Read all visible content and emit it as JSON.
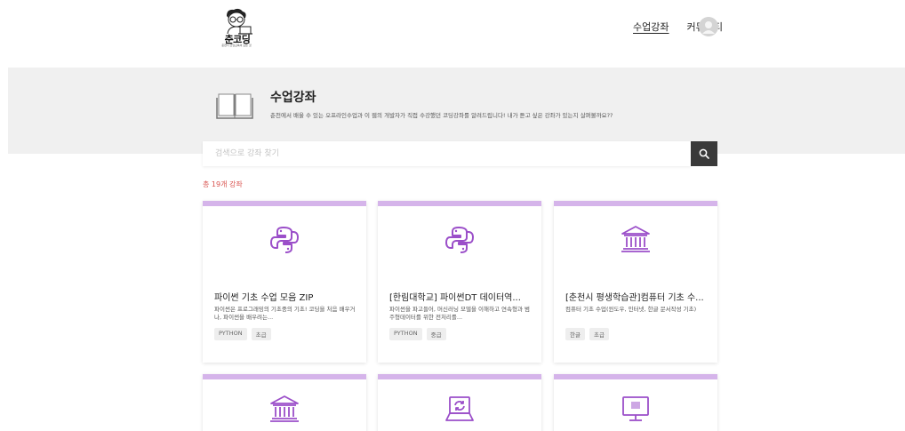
{
  "header": {
    "logo_text": "춘코딩",
    "logo_sub": "춘천시 코딩교육의 모든 것",
    "nav": [
      {
        "label": "수업강좌",
        "active": true
      },
      {
        "label": "커뮤니티",
        "active": false
      }
    ]
  },
  "banner": {
    "title": "수업강좌",
    "description": "춘천에서 배울 수 있는 오프라인수업과 이 웹의 개발자가 직접 수강했던 코딩강좌를 알려드립니다! 내가 듣고 싶은 강좌가 있는지 살펴볼까요??"
  },
  "search": {
    "placeholder": "검색으로 강좌 찾기"
  },
  "count_text": "총 19개 강좌",
  "colors": {
    "card_bar": "#d5b4ea",
    "icon_purple": "#9b4fc9",
    "count_red": "#d9534f",
    "search_button": "#3a3a3a"
  },
  "cards": [
    {
      "icon": "python-icon",
      "title": "파이썬 기초 수업 모음 ZIP",
      "description": "파이썬은 프로그래밍의 기초중의 기초! 코딩을 처음 배우거나, 파이썬을 배우려는...",
      "tags": [
        "PYTHON",
        "초급"
      ]
    },
    {
      "icon": "python-icon",
      "title": "[한림대학교] 파이썬DT 데이터역...",
      "description": "파이썬을 파고들어, 머신러닝 모델을 이해하고 연속형과 범주형데이터를 위한 전처리를...",
      "tags": [
        "PYTHON",
        "중급"
      ]
    },
    {
      "icon": "institution-icon",
      "title": "[춘천시 평생학습관]컴퓨터 기초 수...",
      "description": "컴퓨터 기초 수업(윈도우, 인터넷, 한글 문서작성 기초)",
      "tags": [
        "한글",
        "초급"
      ]
    },
    {
      "icon": "institution-icon"
    },
    {
      "icon": "laptop-sync-icon"
    },
    {
      "icon": "monitor-icon"
    }
  ]
}
